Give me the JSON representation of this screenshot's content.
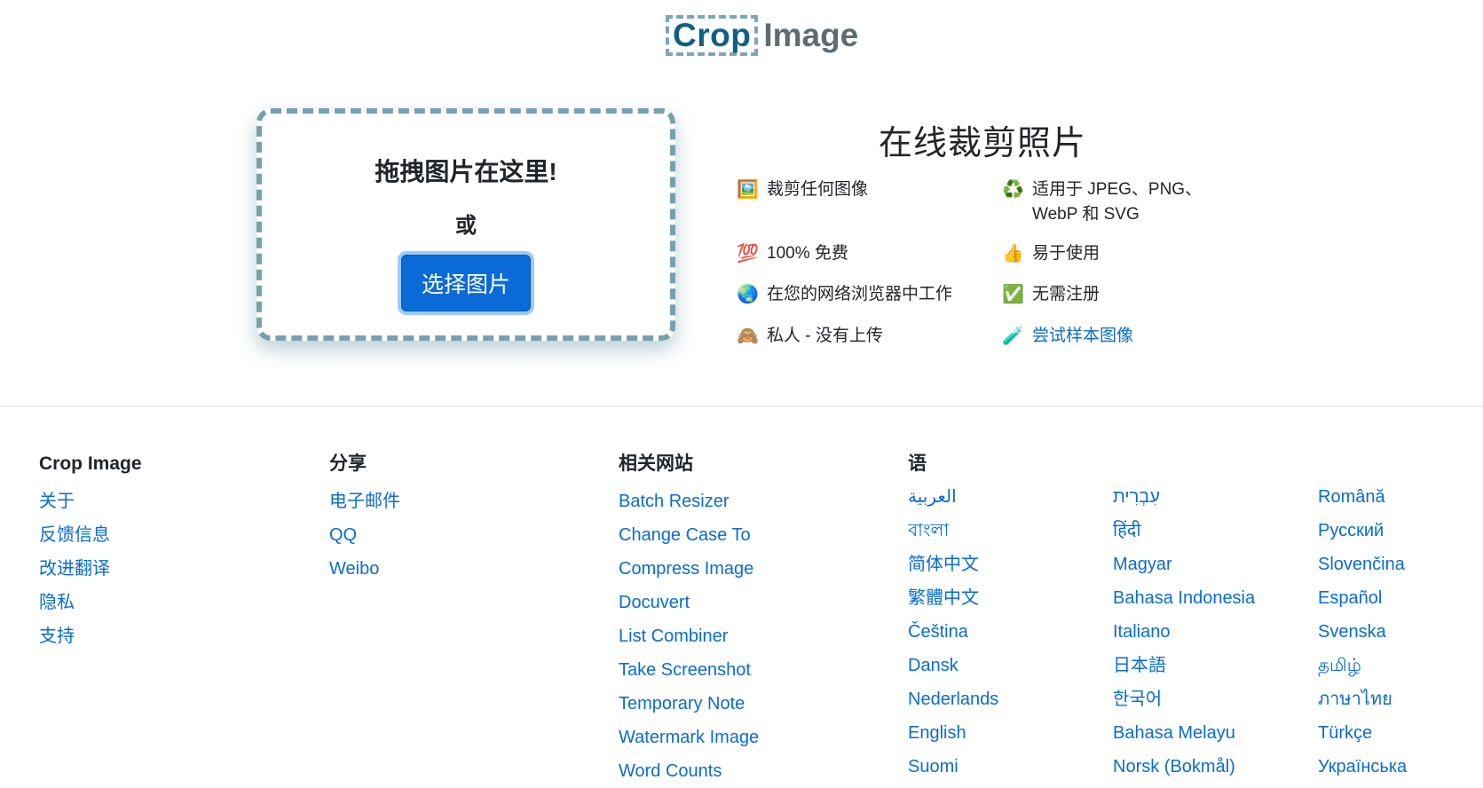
{
  "logo": {
    "crop": "Crop",
    "image": "Image"
  },
  "dropzone": {
    "title": "拖拽图片在这里!",
    "or": "或",
    "button": "选择图片"
  },
  "info": {
    "title": "在线裁剪照片",
    "features": [
      {
        "icon": "🖼️",
        "icon_name": "picture-icon",
        "text": "裁剪任何图像"
      },
      {
        "icon": "♻️",
        "icon_name": "recycle-icon",
        "text": "适用于 JPEG、PNG、WebP 和 SVG"
      },
      {
        "icon": "💯",
        "icon_name": "hundred-points-icon",
        "text": "100% 免费"
      },
      {
        "icon": "👍",
        "icon_name": "thumbs-up-icon",
        "text": "易于使用"
      },
      {
        "icon": "🌏",
        "icon_name": "globe-icon",
        "text": "在您的网络浏览器中工作"
      },
      {
        "icon": "✅",
        "icon_name": "check-mark-icon",
        "text": "无需注册"
      },
      {
        "icon": "🙈",
        "icon_name": "see-no-evil-monkey-icon",
        "text": "私人 - 没有上传"
      },
      {
        "icon": "🧪",
        "icon_name": "test-tube-icon",
        "text": "尝试样本图像"
      }
    ]
  },
  "footer": {
    "about": {
      "heading": "Crop Image",
      "links": [
        "关于",
        "反馈信息",
        "改进翻译",
        "隐私",
        "支持"
      ]
    },
    "share": {
      "heading": "分享",
      "links": [
        "电子邮件",
        "QQ",
        "Weibo"
      ]
    },
    "related": {
      "heading": "相关网站",
      "links": [
        "Batch Resizer",
        "Change Case To",
        "Compress Image",
        "Docuvert",
        "List Combiner",
        "Take Screenshot",
        "Temporary Note",
        "Watermark Image",
        "Word Counts"
      ]
    },
    "languages": {
      "heading": "语",
      "col1": [
        "العربية",
        "বাংলা",
        "简体中文",
        "繁體中文",
        "Čeština",
        "Dansk",
        "Nederlands",
        "English",
        "Suomi"
      ],
      "col2": [
        "עִבְרִית",
        "हिंदी",
        "Magyar",
        "Bahasa Indonesia",
        "Italiano",
        "日本語",
        "한국어",
        "Bahasa Melayu",
        "Norsk (Bokmål)"
      ],
      "col3": [
        "Română",
        "Русский",
        "Slovenčina",
        "Español",
        "Svenska",
        "தமிழ்",
        "ภาษาไทย",
        "Türkçe",
        "Українська"
      ]
    }
  },
  "colors": {
    "accent": "#0a6ad8",
    "link": "#0a6ccf",
    "dashed_border": "#76a2ae"
  }
}
